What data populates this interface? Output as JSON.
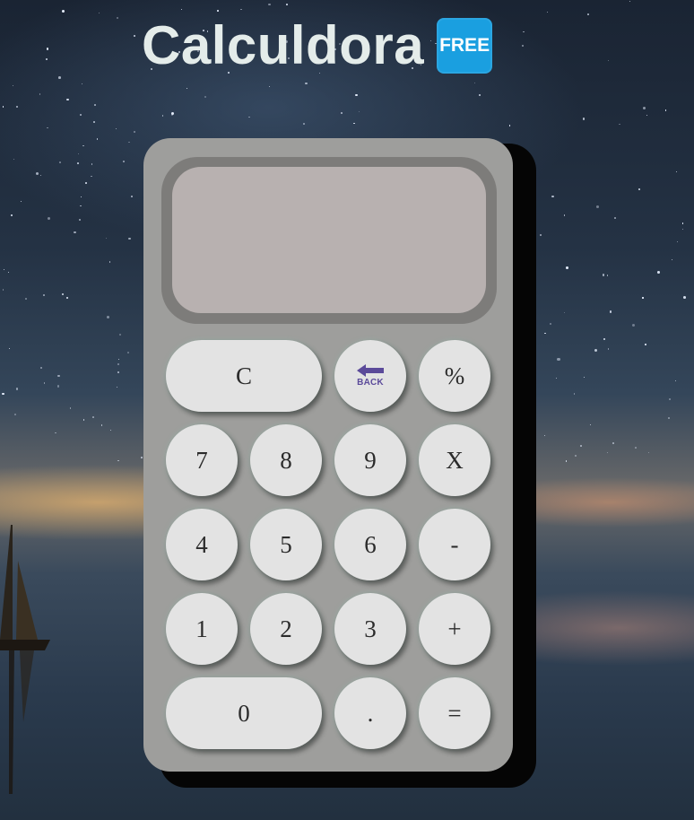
{
  "header": {
    "title": "Calculdora",
    "badge": "FREE"
  },
  "display": {
    "value": ""
  },
  "keys": {
    "clear": "C",
    "back": "BACK",
    "percent": "%",
    "seven": "7",
    "eight": "8",
    "nine": "9",
    "multiply": "X",
    "four": "4",
    "five": "5",
    "six": "6",
    "minus": "-",
    "one": "1",
    "two": "2",
    "three": "3",
    "plus": "+",
    "zero": "0",
    "decimal": ".",
    "equals": "="
  },
  "icons": {
    "back": "back-arrow-icon"
  },
  "colors": {
    "badge": "#1a9fe0",
    "calculator_body": "#9e9e9c",
    "screen": "#b8b1b0",
    "key": "#e3e3e3",
    "back_icon": "#5b4a9a"
  }
}
